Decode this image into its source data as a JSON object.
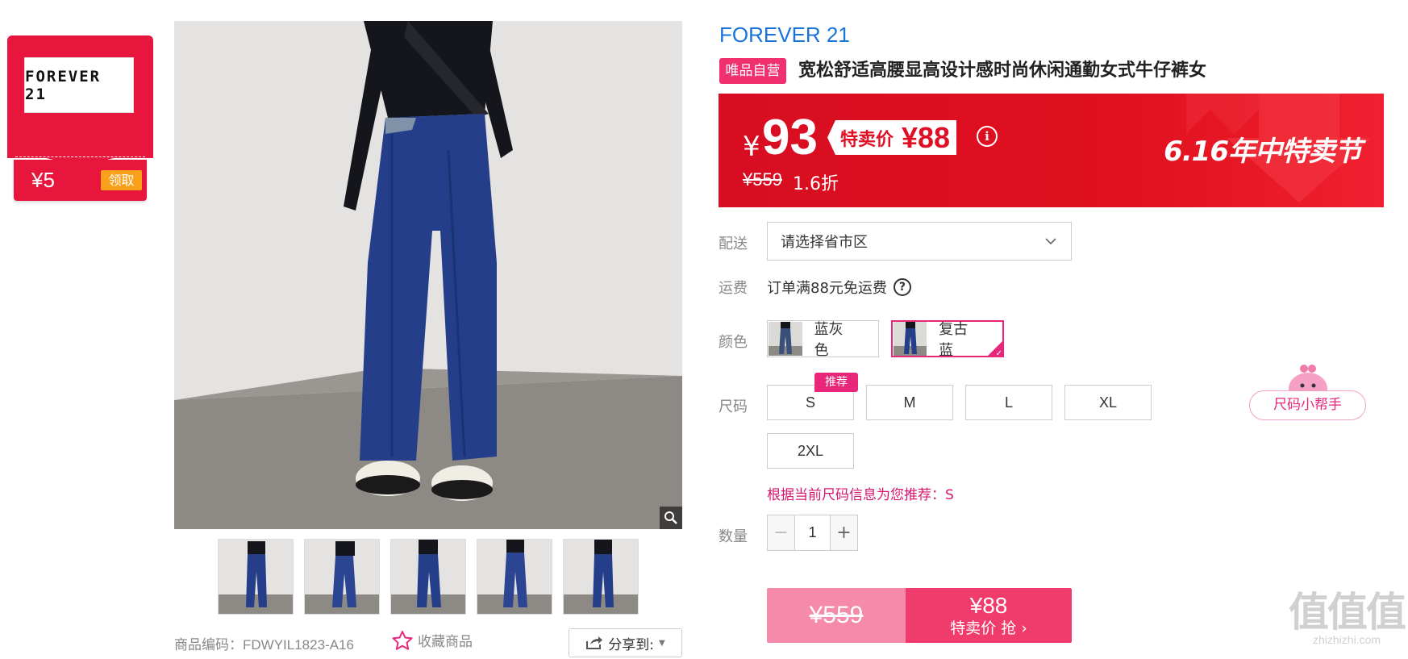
{
  "coupon": {
    "brand_logo": "FOREVER 21",
    "amount": "¥5",
    "action": "领取"
  },
  "gallery": {
    "thumb_count": 5
  },
  "product": {
    "sku": "商品编码：FDWYIL1823-A16",
    "favorite_label": "收藏商品",
    "share_label": "分享到:",
    "brand": "FOREVER 21",
    "self_operated": "唯品自营",
    "title": "宽松舒适高腰显高设计感时尚休闲通勤女式牛仔裤女"
  },
  "price": {
    "yen": "¥",
    "now": "93",
    "special_label": "特卖价",
    "special_price": "¥88",
    "original": "¥559",
    "discount": "1.6折",
    "festival": "6.16年中特卖节"
  },
  "delivery": {
    "label": "配送",
    "placeholder": "请选择省市区"
  },
  "shipping": {
    "label": "运费",
    "text": "订单满88元免运费"
  },
  "colors": {
    "label": "颜色",
    "options": [
      {
        "name": "蓝灰色",
        "selected": false
      },
      {
        "name": "复古蓝",
        "selected": true
      }
    ]
  },
  "sizes": {
    "label": "尺码",
    "recommend_tag": "推荐",
    "options": [
      "S",
      "M",
      "L",
      "XL",
      "2XL"
    ],
    "helper": "尺码小帮手",
    "recommend_text": "根据当前尺码信息为您推荐：S"
  },
  "quantity": {
    "label": "数量",
    "value": "1"
  },
  "buy": {
    "original": "¥559",
    "price": "¥88",
    "action": "特卖价 抢 ›"
  },
  "watermark": {
    "logo": "值值值",
    "url": "zhizhizhi.com"
  },
  "colors_theme": {
    "brand_red": "#e8163d",
    "accent_pink": "#e8267a",
    "link_blue": "#1a73d9"
  }
}
